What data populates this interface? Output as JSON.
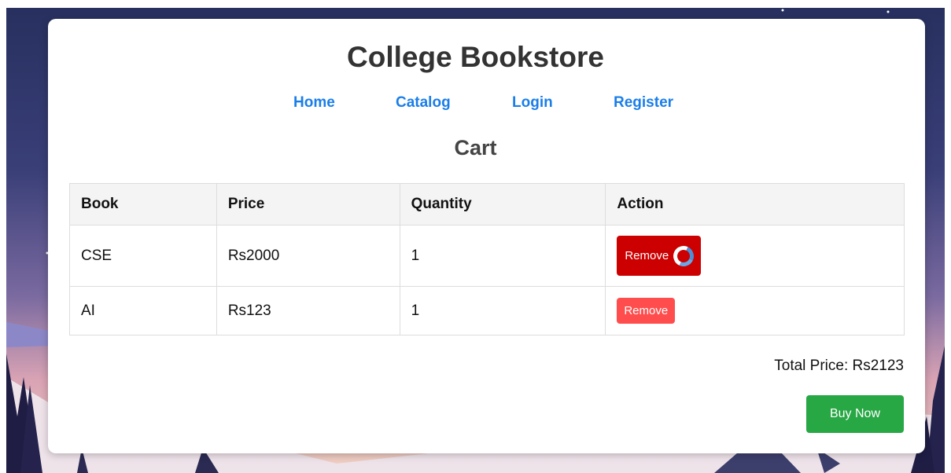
{
  "site": {
    "title": "College Bookstore"
  },
  "nav": {
    "items": [
      {
        "label": "Home"
      },
      {
        "label": "Catalog"
      },
      {
        "label": "Login"
      },
      {
        "label": "Register"
      }
    ]
  },
  "cart": {
    "heading": "Cart",
    "columns": [
      "Book",
      "Price",
      "Quantity",
      "Action"
    ],
    "rows": [
      {
        "book": "CSE",
        "price": "Rs2000",
        "quantity": "1",
        "action_label": "Remove",
        "state": "loading"
      },
      {
        "book": "AI",
        "price": "Rs123",
        "quantity": "1",
        "action_label": "Remove",
        "state": "normal"
      }
    ],
    "total_text": "Total Price: Rs2123",
    "buy_label": "Buy Now"
  },
  "colors": {
    "link": "#1a7ee8",
    "remove_active": "#cc0000",
    "remove_normal": "#ff4d4d",
    "buy": "#28a745",
    "spinner_accent": "#4a8fd8"
  },
  "icons": {
    "loading": "spinner-icon"
  }
}
